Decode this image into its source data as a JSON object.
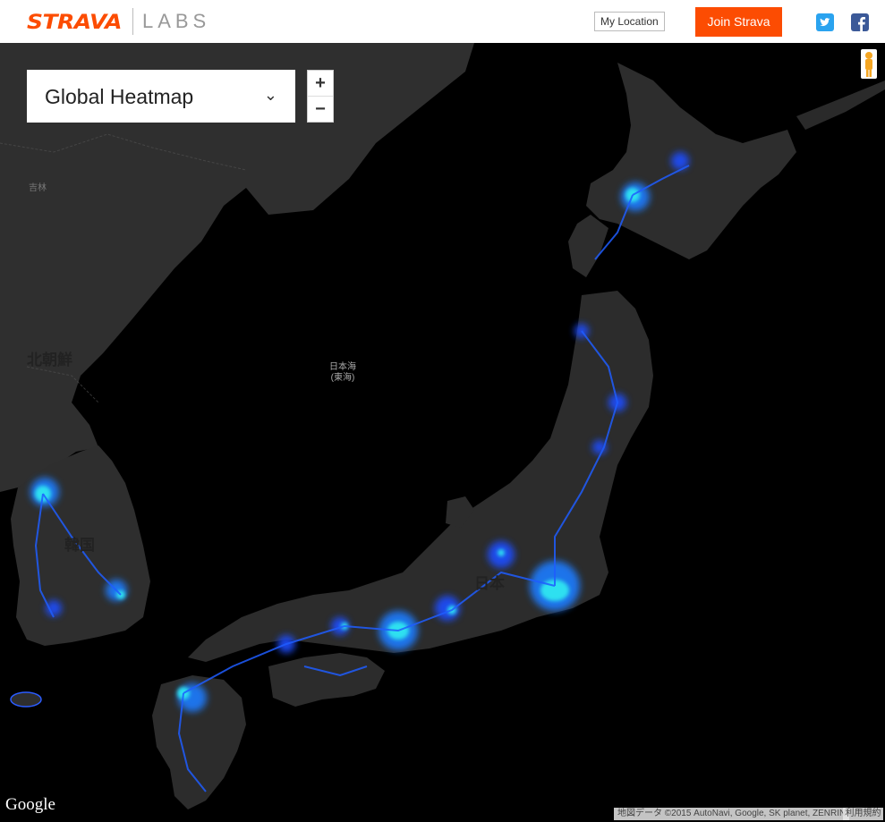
{
  "header": {
    "logo_brand": "STRAVA",
    "logo_sub": "LABS",
    "my_location": "My Location",
    "join": "Join Strava"
  },
  "map": {
    "selector_label": "Global Heatmap",
    "zoom_in": "+",
    "zoom_out": "−",
    "labels": {
      "sea": "日本海\n(東海)",
      "north_korea": "北朝鮮",
      "south_korea": "韓国",
      "japan": "日本",
      "china_city": "吉林"
    },
    "google": "Google",
    "attribution": "地図データ ©2015 AutoNavi, Google, SK planet, ZENRIN",
    "terms": "利用規約"
  },
  "colors": {
    "brand": "#fc4c02",
    "heat_low": "#1a4dff",
    "heat_high": "#2de0f0"
  }
}
